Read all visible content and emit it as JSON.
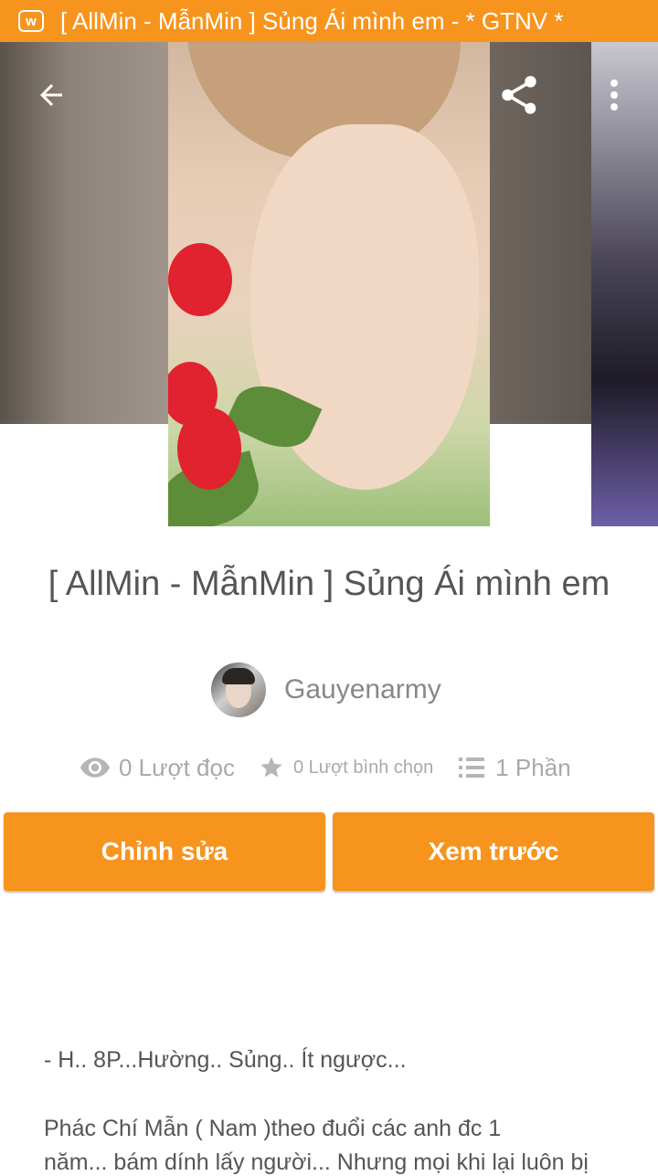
{
  "status_bar": {
    "app_icon": "wattpad-icon",
    "title": "[ AllMin - MẫnMin ] Sủng Ái mình em - * GTNV *"
  },
  "toolbar": {
    "back_icon": "arrow-left-icon",
    "share_icon": "share-icon",
    "more_icon": "more-vertical-icon"
  },
  "story": {
    "title": "[ AllMin - MẫnMin ] Sủng Ái mình em",
    "author": "Gauyenarmy",
    "stats": {
      "reads": "0 Lượt đọc",
      "votes": "0 Lượt bình chọn",
      "parts": "1 Phần"
    }
  },
  "actions": {
    "edit_label": "Chỉnh sửa",
    "preview_label": "Xem trước"
  },
  "description": {
    "line1": "- H.. 8P...Hường.. Sủng.. Ít ngược...",
    "line2": "Phác Chí Mẫn ( Nam )theo đuổi các anh đc 1",
    "line3": "năm... bám dính lấy người... Nhưng mọi khi lại luôn bị"
  },
  "colors": {
    "accent": "#f7941d",
    "text": "#555555",
    "muted": "#a9a9a9"
  }
}
